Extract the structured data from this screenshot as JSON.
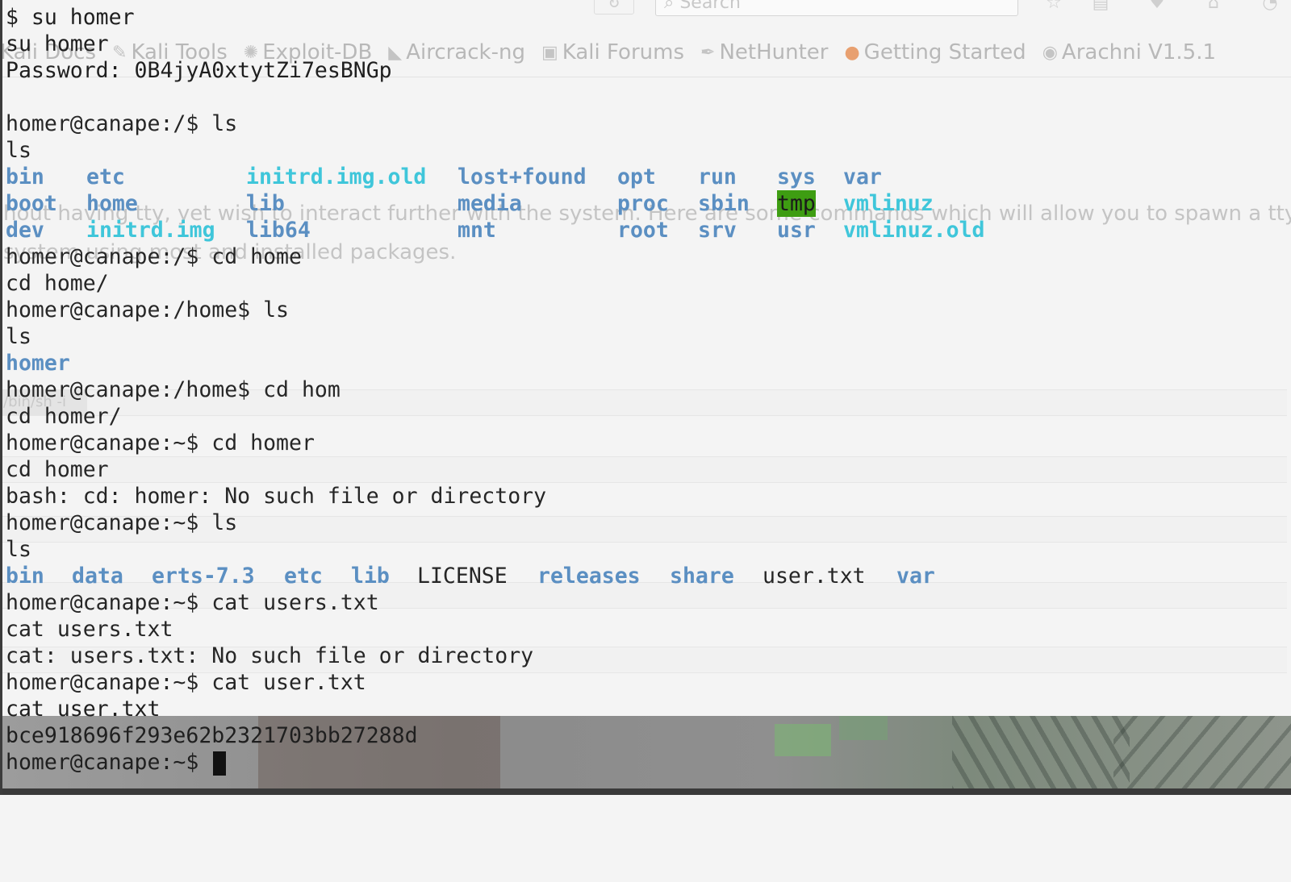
{
  "browser": {
    "search_placeholder": "Search",
    "reload_glyph": "↻",
    "toolbar_icons": [
      "star-icon",
      "reading-list-icon",
      "pocket-icon",
      "home-icon",
      "menu-icon"
    ],
    "bookmarks": [
      {
        "label": "Kali Docs",
        "icon": "kali-docs-icon"
      },
      {
        "label": "Kali Tools",
        "icon": "kali-tools-icon"
      },
      {
        "label": "Exploit-DB",
        "icon": "exploit-db-icon"
      },
      {
        "label": "Aircrack-ng",
        "icon": "aircrack-icon"
      },
      {
        "label": "Kali Forums",
        "icon": "kali-forums-icon"
      },
      {
        "label": "NetHunter",
        "icon": "nethunter-icon"
      },
      {
        "label": "Getting Started",
        "icon": "firefox-icon"
      },
      {
        "label": "Arachni V1.5.1",
        "icon": "arachni-icon"
      }
    ],
    "page_text_1": "hout having tty, yet wish to interact further with the system. Here are some commands which will allow you to spawn a tty",
    "page_text_2": "system using most and installed packages.",
    "chip_text": "/bin/sh -i"
  },
  "terminal": {
    "colors": {
      "directory": "#5b8fc2",
      "executable": "#3fc6da",
      "highlight": "#3e9d12",
      "text": "#262626"
    },
    "lines": {
      "l0": "$ su homer",
      "l1": "su homer",
      "l2": "Password: 0B4jyA0xtytZi7esBNGp",
      "l4": "homer@canape:/$ ls",
      "l5": "ls",
      "l9": "homer@canape:/$ cd home",
      "l10": "cd home/",
      "l11": "homer@canape:/home$ ls",
      "l12": "ls",
      "l13": "homer",
      "l14": "homer@canape:/home$ cd hom",
      "l15": "cd homer/",
      "l16": "homer@canape:~$ cd homer",
      "l17": "cd homer",
      "l18": "bash: cd: homer: No such file or directory",
      "l19": "homer@canape:~$ ls",
      "l20": "ls",
      "l22": "homer@canape:~$ cat users.txt",
      "l23": "cat users.txt",
      "l24": "cat: users.txt: No such file or directory",
      "l25": "homer@canape:~$ cat user.txt",
      "l26": "cat user.txt",
      "l27": "bce918696f293e62b2321703bb27288d",
      "l28": "homer@canape:~$ "
    },
    "root_listing": {
      "row1": [
        "bin",
        "etc",
        "initrd.img.old",
        "lost+found",
        "opt",
        "run",
        "sys",
        "var"
      ],
      "row2": [
        "boot",
        "home",
        "lib",
        "media",
        "proc",
        "sbin",
        "tmp",
        "vmlinuz"
      ],
      "row3": [
        "dev",
        "initrd.img",
        "lib64",
        "mnt",
        "root",
        "srv",
        "usr",
        "vmlinuz.old"
      ]
    },
    "home_listing": [
      "bin",
      "data",
      "erts-7.3",
      "etc",
      "lib",
      "LICENSE",
      "releases",
      "share",
      "user.txt",
      "var"
    ]
  }
}
